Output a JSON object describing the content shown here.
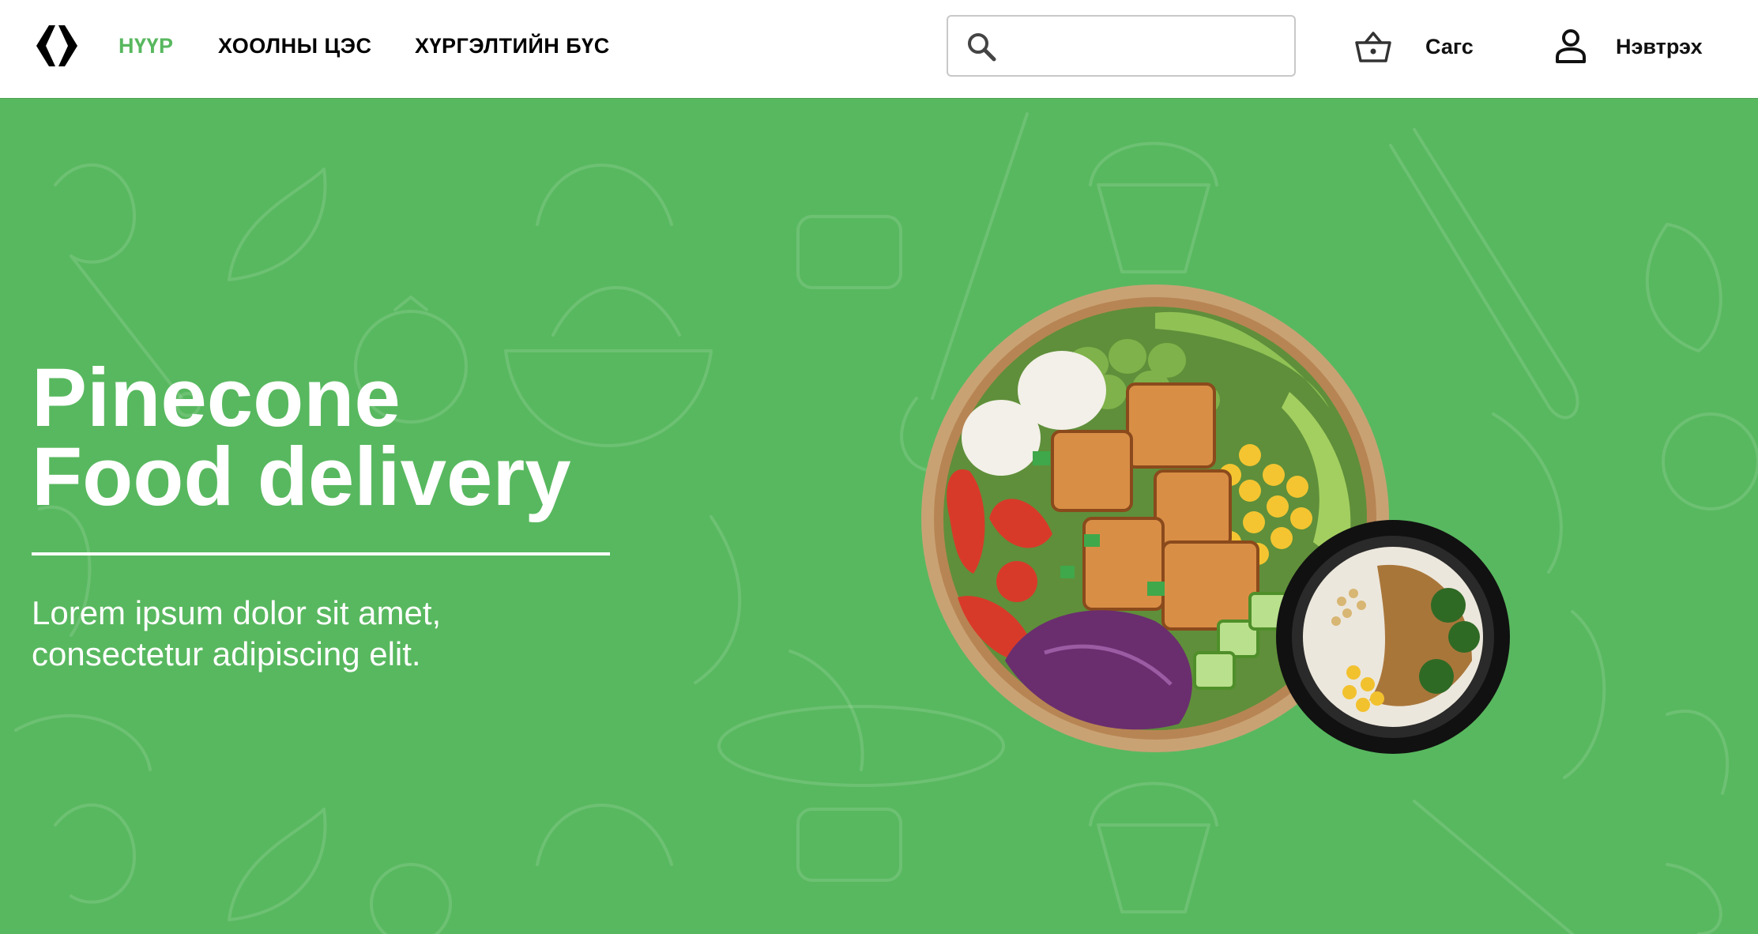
{
  "header": {
    "logo_icon": "curly-brackets-logo",
    "nav": [
      {
        "label": "НҮҮР",
        "active": true
      },
      {
        "label": "ХООЛНЫ ЦЭС",
        "active": false
      },
      {
        "label": "ХҮРГЭЛТИЙН БҮС",
        "active": false
      }
    ],
    "search": {
      "value": "",
      "placeholder": "",
      "icon": "search-icon"
    },
    "cart": {
      "label": "Сагс",
      "icon": "basket-icon"
    },
    "user": {
      "label": "Нэвтрэх",
      "icon": "user-icon"
    }
  },
  "hero": {
    "title_line1": "Pinecone",
    "title_line2": "Food delivery",
    "subtitle_line1": "Lorem ipsum dolor sit amet,",
    "subtitle_line2": "consectetur adipiscing elit."
  },
  "colors": {
    "accent": "#58b85f",
    "header_bg": "#ffffff",
    "text_dark": "#000000",
    "hero_text": "#ffffff"
  }
}
